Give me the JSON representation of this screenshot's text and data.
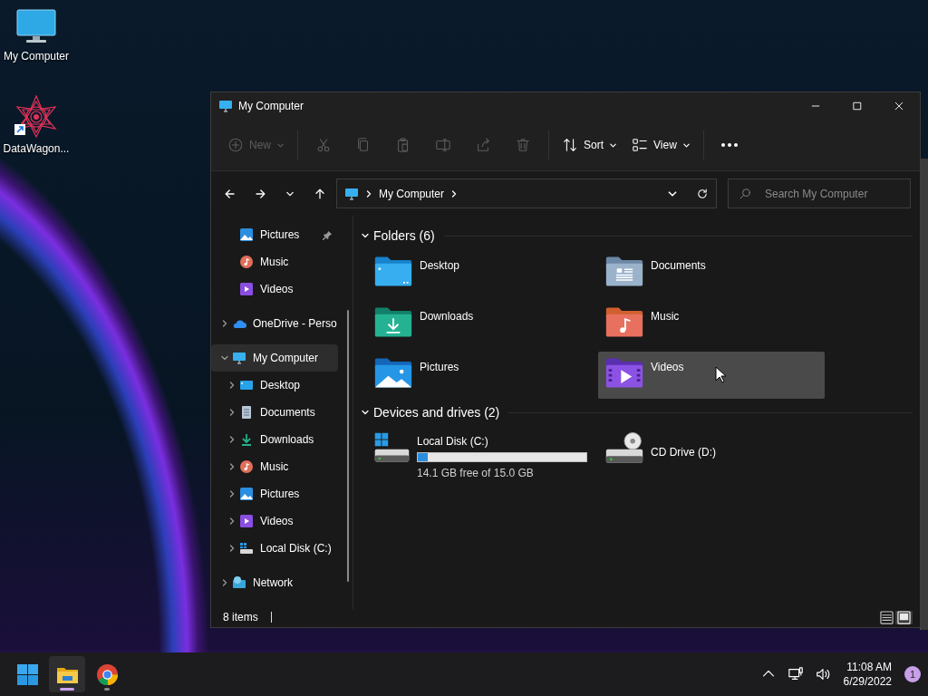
{
  "desktop_icons": [
    {
      "kind": "computer",
      "label": "My Computer"
    },
    {
      "kind": "shortcut",
      "label": "DataWagon..."
    }
  ],
  "window": {
    "title": "My Computer"
  },
  "toolbar": [
    {
      "kind": "new",
      "label": "New",
      "disabled": true
    },
    {
      "kind": "cut",
      "disabled": true
    },
    {
      "kind": "copy",
      "disabled": true
    },
    {
      "kind": "paste",
      "disabled": true
    },
    {
      "kind": "rename",
      "disabled": true
    },
    {
      "kind": "share",
      "disabled": true
    },
    {
      "kind": "delete",
      "disabled": true
    },
    {
      "kind": "sort",
      "label": "Sort",
      "disabled": false
    },
    {
      "kind": "view",
      "label": "View",
      "disabled": false
    },
    {
      "kind": "more",
      "disabled": false
    }
  ],
  "address_bar": {
    "path": [
      "My Computer"
    ]
  },
  "search": {
    "placeholder": "Search My Computer"
  },
  "sidebar": {
    "items": [
      {
        "kind": "pictures",
        "label": "Pictures",
        "pinned": true,
        "selected": false
      },
      {
        "kind": "music",
        "label": "Music",
        "pinned": false,
        "selected": false
      },
      {
        "kind": "videos",
        "label": "Videos",
        "pinned": false,
        "selected": false
      },
      {
        "kind": "onedrive",
        "label": "OneDrive - Perso",
        "expanded": false,
        "selected": false
      },
      {
        "kind": "computer",
        "label": "My Computer",
        "expanded": true,
        "selected": true,
        "children": [
          {
            "kind": "desktop",
            "label": "Desktop",
            "expanded": false,
            "selected": false
          },
          {
            "kind": "documents",
            "label": "Documents",
            "expanded": false,
            "selected": false
          },
          {
            "kind": "downloads",
            "label": "Downloads",
            "expanded": false,
            "selected": false
          },
          {
            "kind": "music",
            "label": "Music",
            "expanded": false,
            "selected": false
          },
          {
            "kind": "pictures",
            "label": "Pictures",
            "expanded": false,
            "selected": false
          },
          {
            "kind": "videos",
            "label": "Videos",
            "expanded": false,
            "selected": false
          },
          {
            "kind": "disk",
            "label": "Local Disk (C:)",
            "expanded": false,
            "selected": false
          }
        ]
      },
      {
        "kind": "network",
        "label": "Network",
        "expanded": false,
        "selected": false
      }
    ]
  },
  "sections": [
    {
      "title": "Folders (6)",
      "expanded": true,
      "items": [
        {
          "kind": "desktop",
          "label": "Desktop",
          "hovered": false
        },
        {
          "kind": "documents",
          "label": "Documents",
          "hovered": false
        },
        {
          "kind": "downloads",
          "label": "Downloads",
          "hovered": false
        },
        {
          "kind": "music",
          "label": "Music",
          "hovered": false
        },
        {
          "kind": "pictures",
          "label": "Pictures",
          "hovered": false
        },
        {
          "kind": "videos",
          "label": "Videos",
          "hovered": true
        }
      ]
    },
    {
      "title": "Devices and drives (2)",
      "expanded": true,
      "items": [
        {
          "kind": "disk",
          "label": "Local Disk (C:)",
          "level": 0.06,
          "detail": "14.1 GB free of 15.0 GB",
          "hovered": false
        },
        {
          "kind": "cd",
          "label": "CD Drive (D:)",
          "hovered": false
        }
      ]
    }
  ],
  "status_bar": {
    "count": "8 items",
    "views": [
      {
        "kind": "details",
        "selected": false
      },
      {
        "kind": "large_icons",
        "selected": true
      }
    ]
  },
  "taskbar": {
    "apps": [
      {
        "kind": "start",
        "active": false,
        "running": false
      },
      {
        "kind": "explorer",
        "active": true,
        "running": true
      },
      {
        "kind": "browser",
        "active": false,
        "running": true
      }
    ],
    "time": "11:08 AM",
    "date": "6/29/2022",
    "notification_count": "1"
  }
}
